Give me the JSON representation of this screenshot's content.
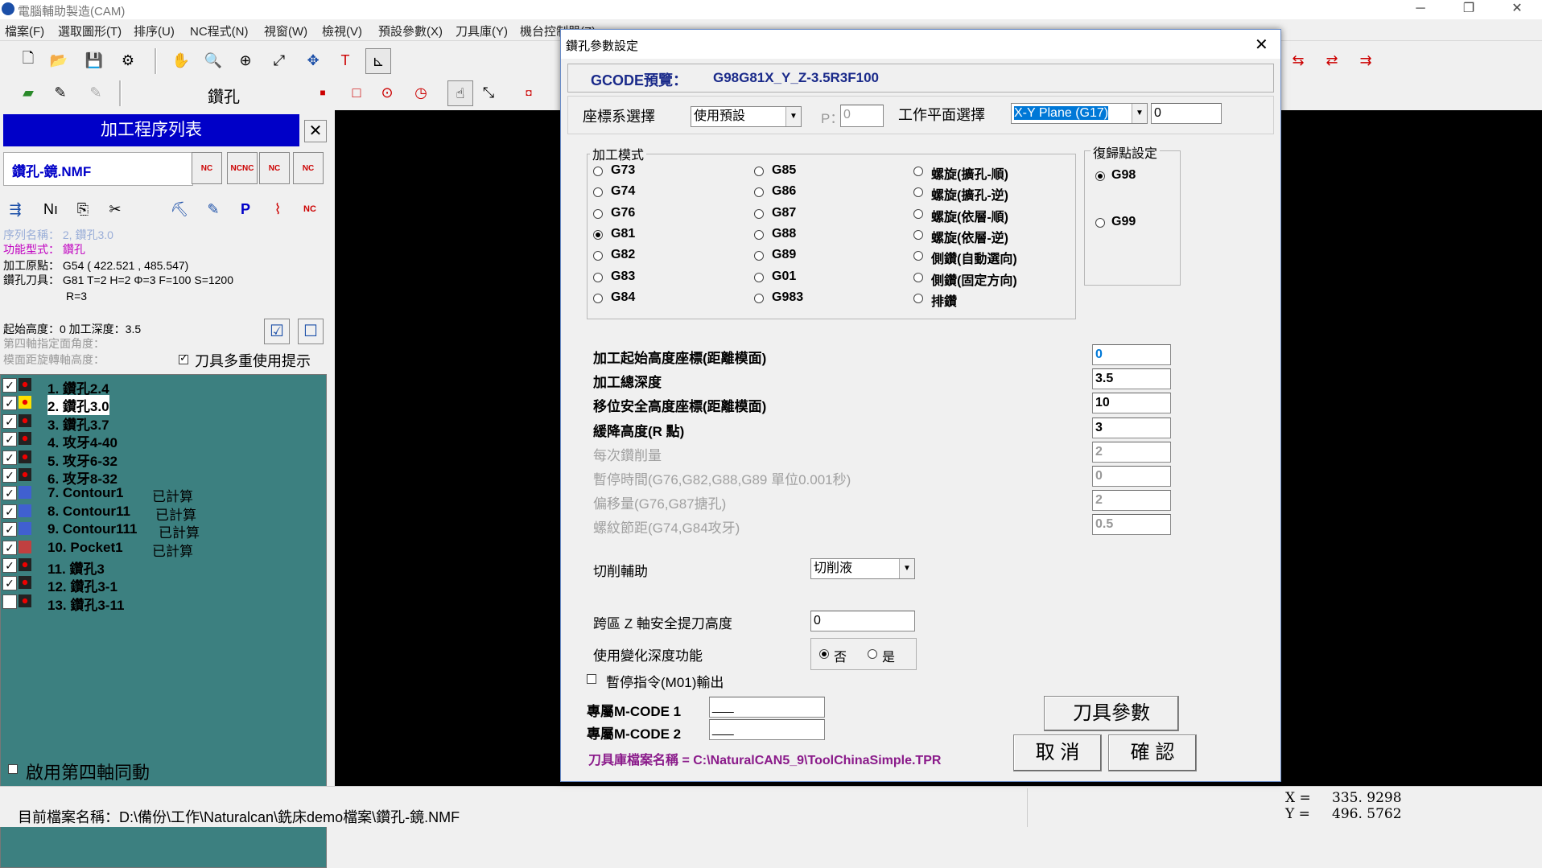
{
  "window": {
    "title": "電腦輔助製造(CAM)",
    "menu": [
      "檔案(F)",
      "選取圖形(T)",
      "排序(U)",
      "NC程式(N)",
      "視窗(W)",
      "檢視(V)",
      "預設參數(X)",
      "刀具庫(Y)",
      "機台控制器(Z)"
    ],
    "toolbar_mode": "鑽孔"
  },
  "left_panel": {
    "header": "加工程序列表",
    "close": "✕",
    "file_name": "鑽孔-鏡.NMF",
    "seq_name": "序列名稱： 2, 鑽孔3.0",
    "proc_type_label": "功能型式：",
    "proc_type_value": "鑽孔",
    "origin": "加工原點： G54 ( 422.521 , 485.547)",
    "tool_line1": "鑽孔刀具： G81 T=2 H=2 Φ=3 F=100 S=1200",
    "tool_line2": "R=3",
    "start_depth": "起始高度：0 加工深度：3.5",
    "axis4_angle": "第四軸指定面角度：",
    "axis4_dist": "模面距旋轉軸高度：",
    "tool_reuse": "刀具多重使用提示",
    "items": [
      {
        "label": "1. 鑽孔2.4",
        "checked": true,
        "icon": "drill",
        "status": ""
      },
      {
        "label": "2. 鑽孔3.0",
        "checked": true,
        "icon": "drill-selected",
        "status": "",
        "selected": true
      },
      {
        "label": "3. 鑽孔3.7",
        "checked": true,
        "icon": "drill",
        "status": ""
      },
      {
        "label": "4. 攻牙4-40",
        "checked": true,
        "icon": "drill",
        "status": ""
      },
      {
        "label": "5. 攻牙6-32",
        "checked": true,
        "icon": "drill",
        "status": ""
      },
      {
        "label": "6. 攻牙8-32",
        "checked": true,
        "icon": "drill",
        "status": ""
      },
      {
        "label": "7. Contour1",
        "checked": true,
        "icon": "contour",
        "status": "已計算"
      },
      {
        "label": "8. Contour11",
        "checked": true,
        "icon": "contour",
        "status": "已計算"
      },
      {
        "label": "9. Contour111",
        "checked": true,
        "icon": "contour",
        "status": "已計算"
      },
      {
        "label": "10. Pocket1",
        "checked": true,
        "icon": "pocket",
        "status": "已計算"
      },
      {
        "label": "11. 鑽孔3",
        "checked": true,
        "icon": "drill",
        "status": ""
      },
      {
        "label": "12. 鑽孔3-1",
        "checked": true,
        "icon": "drill",
        "status": ""
      },
      {
        "label": "13. 鑽孔3-11",
        "checked": false,
        "icon": "drill",
        "status": ""
      }
    ],
    "axis4_sync": "啟用第四軸同動"
  },
  "status": {
    "file_path": "目前檔案名稱：D:\\備份\\工作\\Naturalcan\\銑床demo檔案\\鑽孔-鏡.NMF",
    "x_label": "X =",
    "x_value": "335. 9298",
    "y_label": "Y =",
    "y_value": "496. 5762"
  },
  "dialog": {
    "title": "鑽孔參數設定",
    "close": "✕",
    "gcode_label": "GCODE預覽：",
    "gcode_value": "G98G81X_Y_Z-3.5R3F100",
    "coord_label": "座標系選擇",
    "coord_value": "使用預設",
    "p_label": "P：",
    "p_value": "0",
    "plane_label": "工作平面選擇",
    "plane_value": "X-Y Plane (G17)",
    "plane_extra": "0",
    "mode_title": "加工模式",
    "modes_col1": [
      "G73",
      "G74",
      "G76",
      "G81",
      "G82",
      "G83",
      "G84"
    ],
    "modes_col2": [
      "G85",
      "G86",
      "G87",
      "G88",
      "G89",
      "G01",
      "G983"
    ],
    "modes_col3": [
      "螺旋(擴孔-順)",
      "螺旋(擴孔-逆)",
      "螺旋(依層-順)",
      "螺旋(依層-逆)",
      "側鑽(自動選向)",
      "側鑽(固定方向)",
      "排鑽"
    ],
    "selected_mode": "G81",
    "return_title": "復歸點設定",
    "return_options": [
      "G98",
      "G99"
    ],
    "selected_return": "G98",
    "params": [
      {
        "label": "加工起始高度座標(距離模面)",
        "value": "0",
        "enabled": true
      },
      {
        "label": "加工總深度",
        "value": "3.5",
        "enabled": true
      },
      {
        "label": "移位安全高度座標(距離模面)",
        "value": "10",
        "enabled": true
      },
      {
        "label": "緩降高度(R 點)",
        "value": "3",
        "enabled": true
      },
      {
        "label": "每次鑽削量",
        "value": "2",
        "enabled": false
      },
      {
        "label": "暫停時間(G76,G82,G88,G89 單位0.001秒)",
        "value": "0",
        "enabled": false
      },
      {
        "label": "偏移量(G76,G87搪孔)",
        "value": "2",
        "enabled": false
      },
      {
        "label": "螺紋節距(G74,G84攻牙)",
        "value": "0.5",
        "enabled": false
      }
    ],
    "cut_assist_label": "切削輔助",
    "cut_assist_value": "切削液",
    "cross_z_label": "跨區 Z 軸安全提刀高度",
    "cross_z_value": "0",
    "var_depth_label": "使用變化深度功能",
    "var_depth_no": "否",
    "var_depth_yes": "是",
    "var_depth_selected": "否",
    "pause_label": "暫停指令(M01)輸出",
    "mcode1_label": "專屬M-CODE 1",
    "mcode1_value": "___",
    "mcode2_label": "專屬M-CODE 2",
    "mcode2_value": "___",
    "tool_param_btn": "刀具參數",
    "cancel_btn": "取 消",
    "ok_btn": "確 認",
    "tool_lib_path": "刀具庫檔案名稱 = C:\\NaturalCAN5_9\\ToolChinaSimple.TPR",
    "colors": {
      "gcode_blue": "#1a2a8a",
      "tool_lib_purple": "#8a1a8a",
      "tree_bg": "#3c8080",
      "header_blue": "#0000c8"
    }
  }
}
